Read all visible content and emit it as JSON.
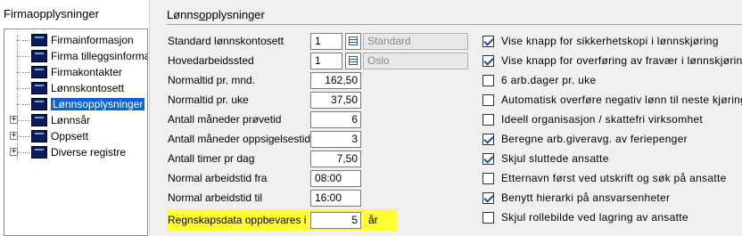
{
  "left_panel": {
    "title": "Firmaopplysninger",
    "tree": [
      {
        "label": "Firmainformasjon",
        "selected": false,
        "expandable": false
      },
      {
        "label": "Firma tilleggsinformasjon",
        "selected": false,
        "expandable": false
      },
      {
        "label": "Firmakontakter",
        "selected": false,
        "expandable": false
      },
      {
        "label": "Lønnskontosett",
        "selected": false,
        "expandable": false
      },
      {
        "label": "Lønnsopplysninger",
        "selected": true,
        "expandable": false
      },
      {
        "label": "Lønnsår",
        "selected": false,
        "expandable": true
      },
      {
        "label": "Oppsett",
        "selected": false,
        "expandable": true
      },
      {
        "label": "Diverse registre",
        "selected": false,
        "expandable": true
      }
    ]
  },
  "section": {
    "title_pre": "Lønns",
    "title_underlined": "o",
    "title_post": "pplysninger"
  },
  "fields": {
    "standard_lonnskontosett": {
      "label": "Standard lønnskontosett",
      "code": "1",
      "name": "Standard"
    },
    "hovedarbeidssted": {
      "label": "Hovedarbeidssted",
      "code": "1",
      "name": "Oslo"
    },
    "normaltid_mnd": {
      "label": "Normaltid pr. mnd.",
      "value": "162,50"
    },
    "normaltid_uke": {
      "label": "Normaltid pr. uke",
      "value": "37,50"
    },
    "maneder_provetid": {
      "label": "Antall måneder prøvetid",
      "value": "6"
    },
    "maneder_oppsigelsestid": {
      "label": "Antall måneder oppsigelsestid",
      "value": "3"
    },
    "timer_pr_dag": {
      "label": "Antall timer pr dag",
      "value": "7,50"
    },
    "arbeidstid_fra": {
      "label": "Normal arbeidstid fra",
      "value": "08:00"
    },
    "arbeidstid_til": {
      "label": "Normal arbeidstid til",
      "value": "16:00"
    },
    "regnskapsdata": {
      "label": "Regnskapsdata oppbevares i",
      "value": "5",
      "suffix": "år"
    }
  },
  "checkboxes": [
    {
      "label": "Vise knapp for sikkerhetskopi i lønnskjøring",
      "checked": true
    },
    {
      "label": "Vise knapp for overføring av fravær i lønnskjøring",
      "checked": true
    },
    {
      "label": "6 arb.dager pr. uke",
      "checked": false
    },
    {
      "label": "Automatisk overføre negativ lønn til neste kjøring",
      "checked": false
    },
    {
      "label": "Ideell organisasjon / skattefri virksomhet",
      "checked": false
    },
    {
      "label": "Beregne arb.giveravg. av feriepenger",
      "checked": true
    },
    {
      "label": "Skjul sluttede ansatte",
      "checked": true
    },
    {
      "label": "Etternavn først ved utskrift og søk på ansatte",
      "checked": false
    },
    {
      "label": "Benytt hierarki på ansvarsenheter",
      "checked": true
    },
    {
      "label": "Skjul rollebilde ved lagring av ansatte",
      "checked": false
    }
  ],
  "colors": {
    "selection": "#0a64d8",
    "highlight": "#ffff33",
    "check": "#1a4fa0"
  }
}
